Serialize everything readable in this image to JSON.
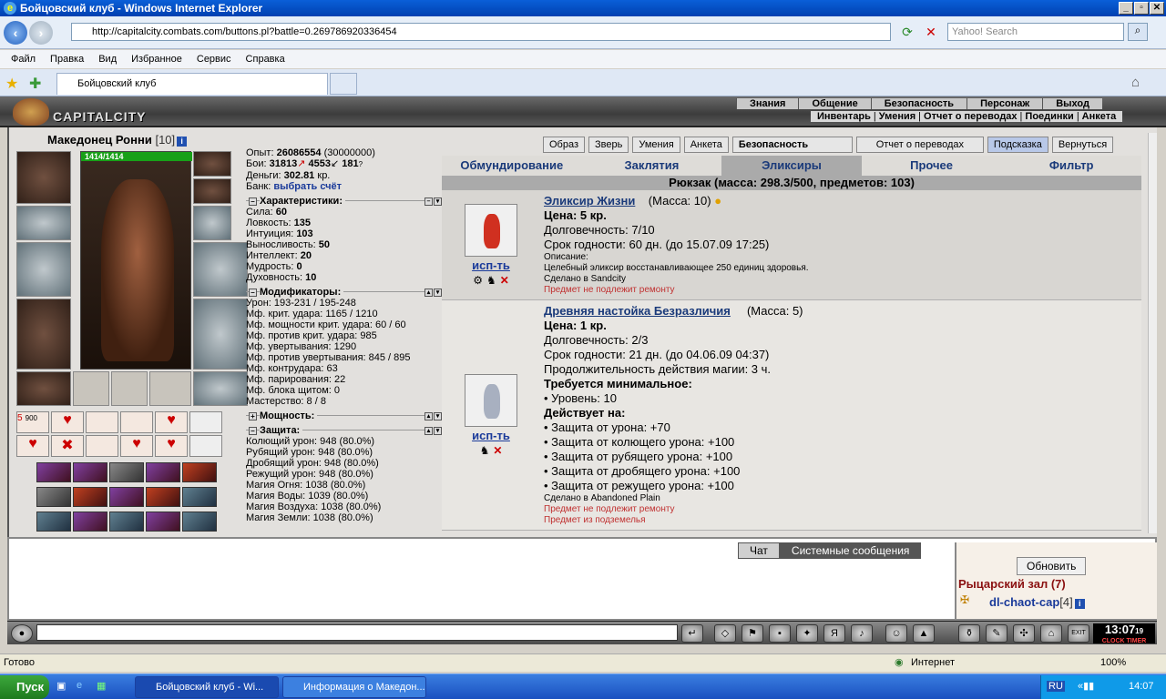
{
  "window": {
    "title": "Бойцовский клуб - Windows Internet Explorer",
    "min": "_",
    "max": "▫",
    "close": "✕"
  },
  "browser": {
    "url": "http://capitalcity.combats.com/buttons.pl?battle=0.269786920336454",
    "search_placeholder": "Yahoo! Search",
    "menu": [
      "Файл",
      "Правка",
      "Вид",
      "Избранное",
      "Сервис",
      "Справка"
    ],
    "tab_title": "Бойцовский клуб"
  },
  "game": {
    "city": "CAPITALCITY",
    "top_nav": [
      "Знания",
      "Общение",
      "Безопасность",
      "Персонаж",
      "Выход"
    ],
    "sub_nav": [
      "Инвентарь",
      "Умения",
      "Отчет о переводах",
      "Поединки",
      "Анкета"
    ],
    "character": {
      "name": "Македонец Ронни",
      "level": "[10]",
      "hp": "1414/1414",
      "exp_label": "Опыт:",
      "exp": "26086554",
      "exp_next": "(30000000)",
      "fights_label": "Бои:",
      "wins": "31813",
      "losses": "4553",
      "draws": "181",
      "money_label": "Деньги:",
      "money": "302.81",
      "money_unit": "кр.",
      "bank_label": "Банк:",
      "bank_link": "выбрать счёт",
      "skill_badge": "5",
      "skill_badge2": "900"
    },
    "sections": {
      "chars": "Характеристики:",
      "mods": "Модификаторы:",
      "powers": "Мощность:",
      "defense": "Защита:"
    },
    "stats": [
      {
        "label": "Сила:",
        "value": "60"
      },
      {
        "label": "Ловкость:",
        "value": "135"
      },
      {
        "label": "Интуиция:",
        "value": "103"
      },
      {
        "label": "Выносливость:",
        "value": "50"
      },
      {
        "label": "Интеллект:",
        "value": "20"
      },
      {
        "label": "Мудрость:",
        "value": "0"
      },
      {
        "label": "Духовность:",
        "value": "10"
      }
    ],
    "mods": [
      "Урон: 193-231 / 195-248",
      "Мф. крит. удара: 1165 / 1210",
      "Мф. мощности крит. удара: 60 / 60",
      "Мф. против крит. удара: 985",
      "Мф. увертывания: 1290",
      "Мф. против увертывания: 845 / 895",
      "Мф. контрудара: 63",
      "Мф. парирования: 22",
      "Мф. блока щитом: 0",
      "Мастерство: 8 / 8"
    ],
    "defense": [
      "Колющий урон: 948 (80.0%)",
      "Рубящий урон: 948 (80.0%)",
      "Дробящий урон: 948 (80.0%)",
      "Режущий урон: 948 (80.0%)",
      "Магия Огня: 1038 (80.0%)",
      "Магия Воды: 1039 (80.0%)",
      "Магия Воздуха: 1038 (80.0%)",
      "Магия Земли: 1038 (80.0%)"
    ],
    "action_buttons": [
      "Образ",
      "Зверь",
      "Умения",
      "Анкета",
      "Безопасность",
      "Отчет о переводах",
      "Подсказка",
      "Вернуться"
    ],
    "inv_tabs": [
      "Обмундирование",
      "Заклятия",
      "Эликсиры",
      "Прочее",
      "Фильтр"
    ],
    "active_tab": "Эликсиры",
    "bag_title": "Рюкзак (масса: 298.3/500, предметов: 103)",
    "items": [
      {
        "name": "Эликсир Жизни",
        "mass": "(Масса: 10)",
        "use": "исп-ть",
        "color": "#d03020",
        "lines": [
          "Цена: 5 кр.",
          "Долговечность: 7/10",
          "Срок годности: 60 дн. (до 15.07.09 17:25)"
        ],
        "desc_label": "Описание:",
        "desc": "Целебный эликсир восстанавливающее 250 единиц здоровья.",
        "made": "Сделано в Sandcity",
        "notes": [
          "Предмет не подлежит ремонту"
        ]
      },
      {
        "name": "Древняя настойка Безразличия",
        "mass": "(Масса: 5)",
        "use": "исп-ть",
        "color": "#a8b0c0",
        "lines": [
          "Цена: 1 кр.",
          "Долговечность: 2/3",
          "Срок годности: 21 дн. (до 04.06.09 04:37)",
          "Продолжительность действия магии: 3 ч."
        ],
        "req_title": "Требуется минимальное:",
        "req": [
          "• Уровень: 10"
        ],
        "eff_title": "Действует на:",
        "effects": [
          "• Защита от урона: +70",
          "• Защита от колющего урона: +100",
          "• Защита от рубящего урона: +100",
          "• Защита от дробящего урона: +100",
          "• Защита от режущего урона: +100"
        ],
        "made": "Сделано в Abandoned Plain",
        "notes": [
          "Предмет не подлежит ремонту",
          "Предмет из подземелья"
        ]
      }
    ],
    "chat": {
      "tab1": "Чат",
      "tab2": "Системные сообщения",
      "refresh": "Обновить",
      "room": "Рыцарский зал (7)",
      "user": "dl-chaot-cap",
      "user_lvl": "[4]"
    },
    "clock": {
      "time": "13:07",
      "sec": "19",
      "label": "CLOCK TIMER"
    }
  },
  "status": {
    "text": "Готово",
    "zone": "Интернет",
    "zoom": "100%"
  },
  "taskbar": {
    "start": "Пуск",
    "tasks": [
      "Бойцовский клуб - Wi...",
      "Информация о Македон..."
    ],
    "lang": "RU",
    "time": "14:07"
  }
}
